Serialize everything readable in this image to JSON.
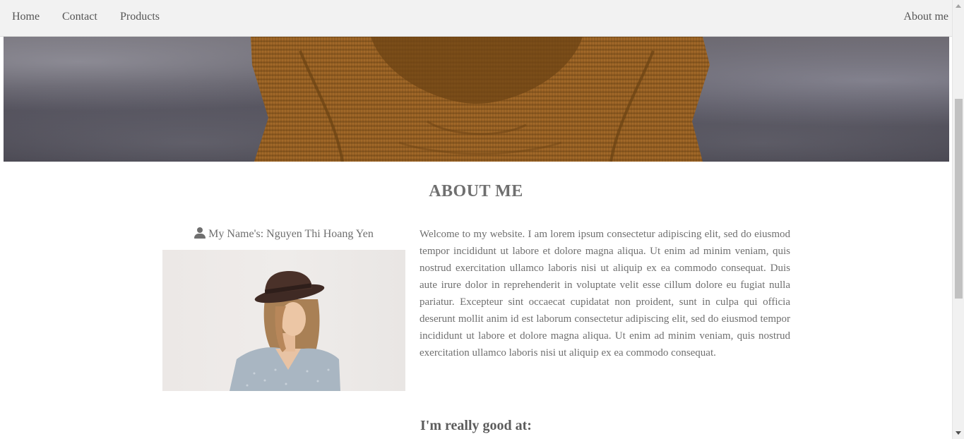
{
  "nav": {
    "home": "Home",
    "contact": "Contact",
    "products": "Products",
    "about": "About me"
  },
  "hero": {
    "image": "person-in-brown-corduroy-jacket"
  },
  "about": {
    "title": "ABOUT ME",
    "name_label": "My Name's: Nguyen Thi Hoang Yen",
    "user_icon": "user-icon",
    "portrait": "woman-in-hat-portrait",
    "intro": "Welcome to my website. I am lorem ipsum consectetur adipiscing elit, sed do eiusmod tempor incididunt ut labore et dolore magna aliqua. Ut enim ad minim veniam, quis nostrud exercitation ullamco laboris nisi ut aliquip ex ea commodo consequat. Duis aute irure dolor in reprehenderit in voluptate velit esse cillum dolore eu fugiat nulla pariatur. Excepteur sint occaecat cupidatat non proident, sunt in culpa qui officia deserunt mollit anim id est laborum consectetur adipiscing elit, sed do eiusmod tempor incididunt ut labore et dolore magna aliqua. Ut enim ad minim veniam, quis nostrud exercitation ullamco laboris nisi ut aliquip ex ea commodo consequat.",
    "skills_heading": "I'm really good at:"
  },
  "colors": {
    "nav_bg": "#f2f2f2",
    "text": "#6f6f6f",
    "jacket": "#9a6424"
  }
}
